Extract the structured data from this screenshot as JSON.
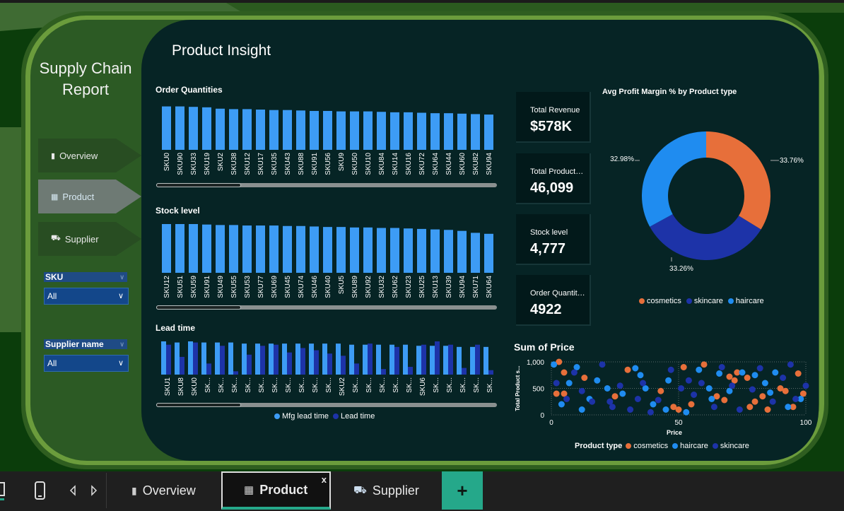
{
  "report": {
    "title_line1": "Supply Chain",
    "title_line2": "Report",
    "page_title": "Product Insight"
  },
  "nav": {
    "overview": "Overview",
    "product": "Product",
    "supplier": "Supplier"
  },
  "slicers": {
    "sku": {
      "label": "SKU",
      "value": "All"
    },
    "supplier": {
      "label": "Supplier name",
      "value": "All"
    }
  },
  "sections": {
    "order_quantities": "Order Quantities",
    "stock_level": "Stock level",
    "lead_time": "Lead time"
  },
  "kpis": [
    {
      "label": "Total Revenue",
      "value": "$578K"
    },
    {
      "label": "Total Products Sold",
      "value": "46,099"
    },
    {
      "label": "Stock level",
      "value": "4,777"
    },
    {
      "label": "Order Quantities",
      "value": "4922"
    }
  ],
  "donut": {
    "title": "Avg Profit Margin % by Product type",
    "labels": {
      "cosmetics": "33.76%",
      "skincare": "33.26%",
      "haircare": "32.98%"
    },
    "legend": [
      "cosmetics",
      "skincare",
      "haircare"
    ]
  },
  "lead_legend": {
    "mfg": "Mfg lead time",
    "lead": "Lead time"
  },
  "scatter": {
    "title": "Sum of Price",
    "ylabel": "Total Product s...",
    "xlabel": "Price",
    "legend_title": "Product type",
    "legend": [
      "cosmetics",
      "haircare",
      "skincare"
    ]
  },
  "colors": {
    "bar": "#3d9cf5",
    "cosmetics": "#e76f3a",
    "skincare": "#1d33a8",
    "haircare": "#1f8cf0"
  },
  "taskbar": {
    "overview": "Overview",
    "product": "Product",
    "supplier": "Supplier",
    "close": "x",
    "add": "+"
  },
  "chart_data": [
    {
      "type": "bar",
      "title": "Order Quantities",
      "categories": [
        "SKU0",
        "SKU90",
        "SKU33",
        "SKU19",
        "SKU2",
        "SKU38",
        "SKU12",
        "SKU17",
        "SKU35",
        "SKU43",
        "SKU88",
        "SKU91",
        "SKU56",
        "SKU9",
        "SKU50",
        "SKU10",
        "SKU84",
        "SKU14",
        "SKU16",
        "SKU72",
        "SKU64",
        "SKU44",
        "SKU60",
        "SKU82",
        "SKU94"
      ],
      "values": [
        96,
        96,
        95,
        94,
        91,
        90,
        90,
        89,
        88,
        88,
        87,
        86,
        86,
        85,
        85,
        85,
        84,
        83,
        83,
        82,
        81,
        81,
        80,
        79,
        78
      ],
      "ylim": [
        0,
        100
      ]
    },
    {
      "type": "bar",
      "title": "Stock level",
      "categories": [
        "SKU12",
        "SKU51",
        "SKU59",
        "SKU91",
        "SKU49",
        "SKU55",
        "SKU53",
        "SKU77",
        "SKU69",
        "SKU45",
        "SKU74",
        "SKU46",
        "SKU40",
        "SKU5",
        "SKU89",
        "SKU92",
        "SKU32",
        "SKU62",
        "SKU23",
        "SKU25",
        "SKU13",
        "SKU39",
        "SKU94",
        "SKU71",
        "SKU64"
      ],
      "values": [
        100,
        100,
        100,
        99,
        98,
        98,
        97,
        97,
        97,
        96,
        96,
        95,
        94,
        94,
        93,
        93,
        92,
        92,
        91,
        90,
        89,
        88,
        86,
        82,
        80
      ],
      "ylim": [
        0,
        100
      ]
    },
    {
      "type": "bar",
      "title": "Lead time",
      "categories": [
        "SKU1",
        "SKU8",
        "SKU0",
        "SK...",
        "SK...",
        "SK...",
        "SK...",
        "SK...",
        "SK...",
        "SK...",
        "SK...",
        "SK...",
        "SK...",
        "SKU2",
        "SK...",
        "SK...",
        "SK...",
        "SK...",
        "SK...",
        "SKU6",
        "SK...",
        "SK...",
        "SK...",
        "SK...",
        "SK..."
      ],
      "series": [
        {
          "name": "Mfg lead time",
          "values": [
            30,
            29,
            30,
            29,
            29,
            29,
            28,
            28,
            28,
            28,
            28,
            28,
            28,
            28,
            27,
            27,
            27,
            27,
            27,
            26,
            26,
            26,
            25,
            25,
            25
          ]
        },
        {
          "name": "Lead time",
          "values": [
            27,
            16,
            29,
            10,
            26,
            3,
            18,
            26,
            27,
            20,
            24,
            22,
            19,
            17,
            10,
            28,
            5,
            25,
            7,
            27,
            30,
            27,
            6,
            27,
            4
          ]
        }
      ],
      "ylim": [
        0,
        30
      ]
    },
    {
      "type": "pie",
      "title": "Avg Profit Margin % by Product type",
      "categories": [
        "cosmetics",
        "skincare",
        "haircare"
      ],
      "values": [
        33.76,
        33.26,
        32.98
      ]
    },
    {
      "type": "scatter",
      "title": "Sum of Price",
      "xlabel": "Price",
      "ylabel": "Total Product s...",
      "xlim": [
        0,
        100
      ],
      "ylim": [
        0,
        1000
      ],
      "series": [
        {
          "name": "cosmetics",
          "points": [
            [
              3,
              1000
            ],
            [
              5,
              800
            ],
            [
              2,
              400
            ],
            [
              5,
              400
            ],
            [
              13,
              700
            ],
            [
              25,
              350
            ],
            [
              30,
              850
            ],
            [
              43,
              450
            ],
            [
              50,
              100
            ],
            [
              52,
              900
            ],
            [
              55,
              200
            ],
            [
              60,
              950
            ],
            [
              68,
              280
            ],
            [
              70,
              720
            ],
            [
              72,
              650
            ],
            [
              73,
              800
            ],
            [
              77,
              700
            ],
            [
              80,
              250
            ],
            [
              83,
              350
            ],
            [
              85,
              100
            ],
            [
              90,
              500
            ],
            [
              92,
              450
            ],
            [
              95,
              150
            ],
            [
              97,
              780
            ],
            [
              99,
              400
            ],
            [
              78,
              150
            ],
            [
              65,
              350
            ],
            [
              48,
              150
            ]
          ]
        },
        {
          "name": "haircare",
          "points": [
            [
              1,
              950
            ],
            [
              4,
              200
            ],
            [
              7,
              600
            ],
            [
              10,
              900
            ],
            [
              15,
              300
            ],
            [
              18,
              650
            ],
            [
              22,
              500
            ],
            [
              28,
              400
            ],
            [
              33,
              880
            ],
            [
              37,
              500
            ],
            [
              40,
              200
            ],
            [
              46,
              650
            ],
            [
              53,
              50
            ],
            [
              58,
              850
            ],
            [
              63,
              300
            ],
            [
              66,
              780
            ],
            [
              70,
              450
            ],
            [
              75,
              800
            ],
            [
              80,
              750
            ],
            [
              84,
              600
            ],
            [
              88,
              800
            ],
            [
              93,
              150
            ],
            [
              98,
              300
            ],
            [
              45,
              100
            ],
            [
              35,
              750
            ],
            [
              12,
              100
            ],
            [
              62,
              500
            ],
            [
              86,
              420
            ]
          ]
        },
        {
          "name": "skincare",
          "points": [
            [
              2,
              600
            ],
            [
              6,
              300
            ],
            [
              9,
              800
            ],
            [
              12,
              450
            ],
            [
              16,
              250
            ],
            [
              20,
              950
            ],
            [
              24,
              150
            ],
            [
              27,
              550
            ],
            [
              31,
              100
            ],
            [
              36,
              600
            ],
            [
              39,
              50
            ],
            [
              42,
              280
            ],
            [
              47,
              850
            ],
            [
              51,
              500
            ],
            [
              56,
              380
            ],
            [
              59,
              600
            ],
            [
              64,
              150
            ],
            [
              67,
              900
            ],
            [
              71,
              550
            ],
            [
              74,
              100
            ],
            [
              79,
              480
            ],
            [
              82,
              880
            ],
            [
              87,
              250
            ],
            [
              91,
              700
            ],
            [
              94,
              950
            ],
            [
              96,
              300
            ],
            [
              100,
              550
            ],
            [
              23,
              250
            ],
            [
              34,
              300
            ],
            [
              54,
              650
            ]
          ]
        }
      ]
    }
  ]
}
